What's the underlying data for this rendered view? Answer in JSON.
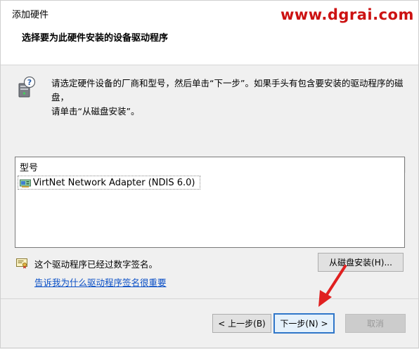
{
  "window": {
    "title": "添加硬件",
    "watermark": "www.dgrai.com"
  },
  "header": {
    "page_title": "选择要为此硬件安装的设备驱动程序"
  },
  "instructions": {
    "line1": "请选定硬件设备的厂商和型号，然后单击“下一步”。如果手头有包含要安装的驱动程序的磁盘，",
    "line2": "请单击“从磁盘安装”。"
  },
  "model_list": {
    "header": "型号",
    "items": [
      "VirtNet Network Adapter (NDIS 6.0)"
    ]
  },
  "signature": {
    "status_text": "这个驱动程序已经过数字签名。",
    "link_text": "告诉我为什么驱动程序签名很重要"
  },
  "buttons": {
    "have_disk": "从磁盘安装(H)...",
    "back": "< 上一步(B)",
    "next": "下一步(N) >",
    "cancel": "取消"
  },
  "colors": {
    "watermark": "#cc1212",
    "link": "#0a4fc6",
    "focus_border": "#2f76c9",
    "arrow": "#e02020"
  },
  "icons": [
    "computer-question-icon",
    "network-adapter-icon",
    "certificate-icon"
  ]
}
